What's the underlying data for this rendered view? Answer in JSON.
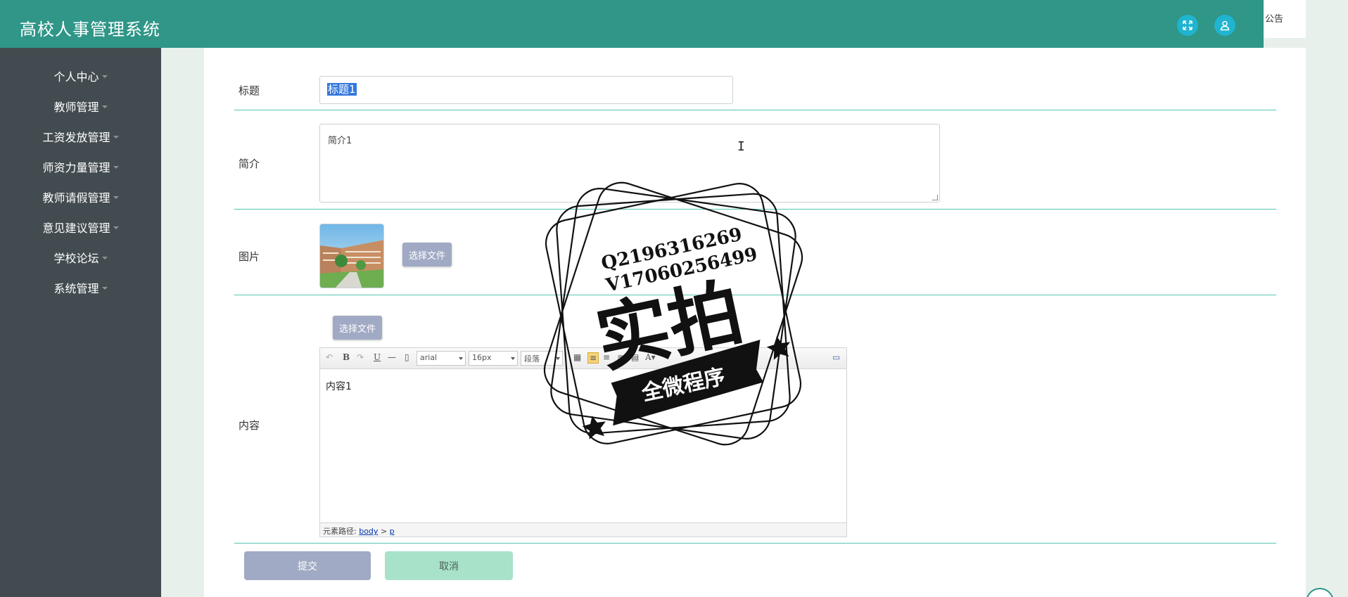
{
  "header": {
    "app_title": "高校人事管理系统",
    "notice_tab": "公告",
    "accent_color": "#2f9688",
    "icons": [
      "fullscreen-icon",
      "user-icon"
    ]
  },
  "sidebar": {
    "items": [
      {
        "label": "个人中心"
      },
      {
        "label": "教师管理"
      },
      {
        "label": "工资发放管理"
      },
      {
        "label": "师资力量管理"
      },
      {
        "label": "教师请假管理"
      },
      {
        "label": "意见建议管理"
      },
      {
        "label": "学校论坛"
      },
      {
        "label": "系统管理"
      }
    ]
  },
  "form": {
    "title_label": "标题",
    "title_value": "标题1",
    "intro_label": "简介",
    "intro_value": "简介1",
    "image_label": "图片",
    "image_button": "选择文件",
    "content_label": "内容",
    "content_button": "选择文件",
    "content_value": "内容1",
    "submit_label": "提交",
    "cancel_label": "取消"
  },
  "editor": {
    "font_family": "arial",
    "font_size": "16px",
    "paragraph": "段落",
    "path_prefix": "元素路径:",
    "path_body": "body",
    "path_sep": ">",
    "path_p": "p"
  },
  "watermark": {
    "line1": "Q2196316269",
    "line2": "V17060256499",
    "main": "实拍",
    "banner": "全微程序"
  }
}
